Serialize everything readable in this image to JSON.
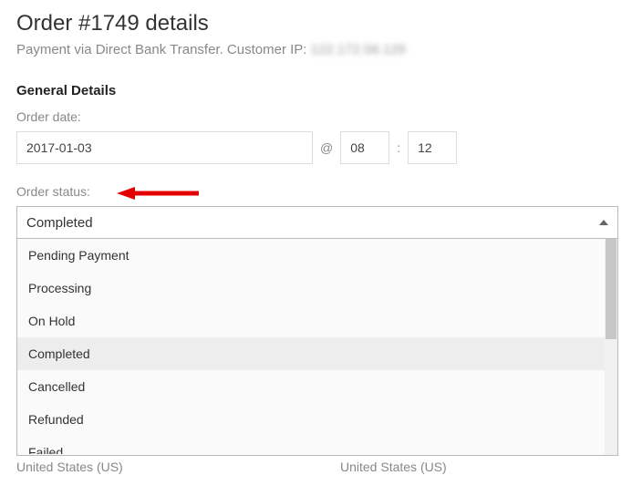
{
  "header": {
    "title": "Order #1749 details",
    "subline_prefix": "Payment via Direct Bank Transfer. Customer IP: ",
    "ip_masked": "122.172.56.129"
  },
  "general": {
    "heading": "General Details",
    "order_date_label": "Order date:",
    "order_date_value": "2017-01-03",
    "at_symbol": "@",
    "hour_value": "08",
    "colon": ":",
    "minute_value": "12",
    "order_status_label": "Order status:",
    "order_status_selected": "Completed"
  },
  "status_options": {
    "0": "Pending Payment",
    "1": "Processing",
    "2": "On Hold",
    "3": "Completed",
    "4": "Cancelled",
    "5": "Refunded",
    "6": "Failed"
  },
  "footer": {
    "left": "United States (US)",
    "right": "United States (US)"
  }
}
